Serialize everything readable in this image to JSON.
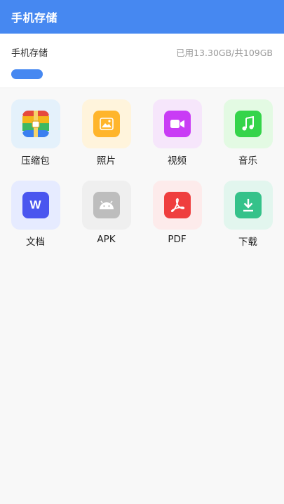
{
  "header": {
    "title": "手机存储"
  },
  "storage": {
    "label": "手机存储",
    "usage_text": "已用13.30GB/共109GB",
    "used_fraction": 0.12
  },
  "categories": [
    {
      "label": "压缩包",
      "icon": "archive-icon",
      "bg": "#e4f1fb"
    },
    {
      "label": "照片",
      "icon": "photo-icon",
      "bg": "#fff4dc"
    },
    {
      "label": "视频",
      "icon": "video-icon",
      "bg": "#f6e6fb"
    },
    {
      "label": "音乐",
      "icon": "music-icon",
      "bg": "#e3fae3"
    },
    {
      "label": "文档",
      "icon": "document-icon",
      "bg": "#e6ebff"
    },
    {
      "label": "APK",
      "icon": "android-icon",
      "bg": "#efefef"
    },
    {
      "label": "PDF",
      "icon": "pdf-icon",
      "bg": "#fdebeb"
    },
    {
      "label": "下载",
      "icon": "download-icon",
      "bg": "#e2f6ee"
    }
  ],
  "colors": {
    "accent": "#4688f1",
    "archive": [
      "#e64a3b",
      "#f4b619",
      "#3db863",
      "#3a7ff0"
    ],
    "photo": "#ffb52b",
    "video": "#c93cf5",
    "music": "#35d44a",
    "document": "#4a56ef",
    "android": "#bdbdbd",
    "pdf": "#ef3e3e",
    "download": "#35c28a"
  }
}
